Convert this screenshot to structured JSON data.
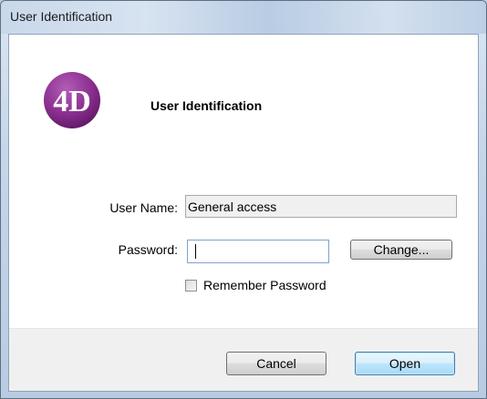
{
  "window": {
    "title": "User Identification"
  },
  "header": {
    "title": "User Identification",
    "logo_text": "4D",
    "logo_color": "#8a2f8f"
  },
  "form": {
    "username_label": "User Name:",
    "username_value": "General access",
    "password_label": "Password:",
    "password_value": "",
    "change_label": "Change...",
    "remember_label": "Remember Password",
    "remember_checked": false
  },
  "buttons": {
    "cancel_label": "Cancel",
    "open_label": "Open"
  }
}
